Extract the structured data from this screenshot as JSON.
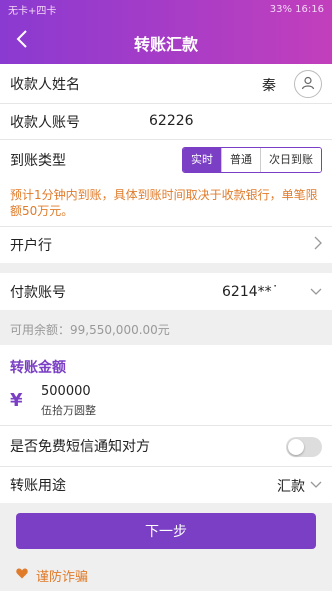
{
  "status_bar": {
    "left": "无卡+四卡",
    "right": "33% 16:16"
  },
  "header": {
    "title": "转账汇款"
  },
  "form": {
    "payee_name_label": "收款人姓名",
    "payee_name_value": "秦",
    "payee_account_label": "收款人账号",
    "payee_account_value": "62226",
    "arrival_type_label": "到账类型",
    "arrival_options": [
      "实时",
      "普通",
      "次日到账"
    ],
    "notice": "预计1分钟内到账，具体到账时间取决于收款银行，单笔限额50万元。",
    "bank_label": "开户行",
    "pay_account_label": "付款账号",
    "pay_account_value": "6214**˙",
    "balance": "可用余额：99,550,000.00元",
    "amount_title": "转账金额",
    "amount_symbol": "¥",
    "amount_value": "500000",
    "amount_chinese": "伍拾万圆整",
    "sms_label": "是否免费短信通知对方",
    "sms_enabled": false,
    "purpose_label": "转账用途",
    "purpose_value": "汇款"
  },
  "next_button": "下一步",
  "fraud_link": "谨防诈骗",
  "colors": {
    "brand": "#7a3fc4",
    "warning": "#e07b2a"
  }
}
